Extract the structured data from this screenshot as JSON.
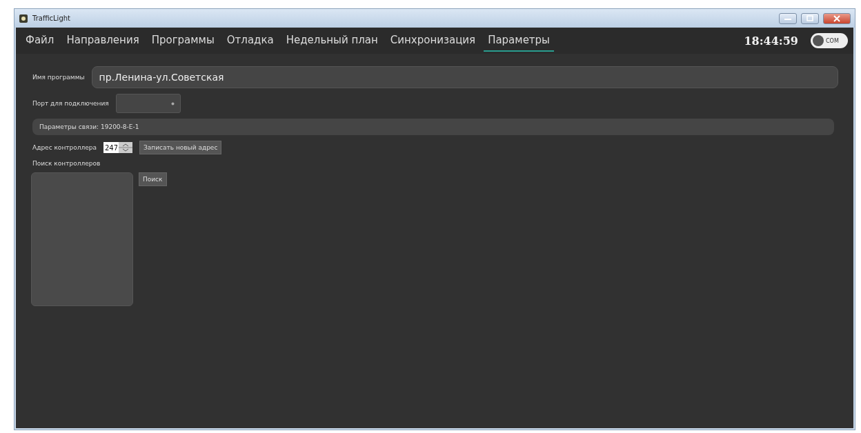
{
  "window": {
    "title": "TrafficLight"
  },
  "tabs": [
    {
      "label": "Файл",
      "selected": false
    },
    {
      "label": "Направления",
      "selected": false
    },
    {
      "label": "Программы",
      "selected": false
    },
    {
      "label": "Отладка",
      "selected": false
    },
    {
      "label": "Недельный план",
      "selected": false
    },
    {
      "label": "Синхронизация",
      "selected": false
    },
    {
      "label": "Параметры",
      "selected": true
    }
  ],
  "clock": "18:44:59",
  "com_toggle": {
    "label": "COM",
    "on": false
  },
  "program_name": {
    "label": "Имя программы",
    "value": "пр.Ленина-ул.Советская"
  },
  "port": {
    "label": "Порт для подключения"
  },
  "connection_params": "Параметры связи: 19200-8-E-1",
  "controller_address": {
    "label": "Адрес контроллера",
    "value": "247",
    "button": "Записать новый адрес"
  },
  "search": {
    "label": "Поиск контроллеров",
    "button": "Поиск"
  }
}
